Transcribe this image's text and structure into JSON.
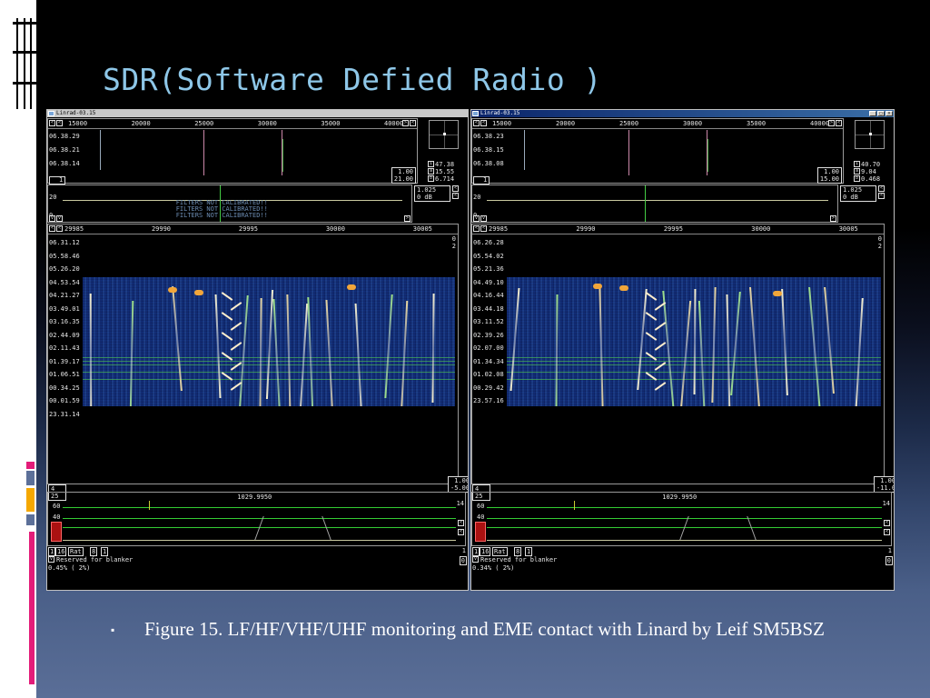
{
  "slide": {
    "title": "SDR(Software Defied Radio )",
    "caption": "Figure 15.  LF/HF/VHF/UHF  monitoring and EME contact with Linard by Leif SM5BSZ",
    "bullet": "▪",
    "colors": {
      "title": "#8ec7e8",
      "caption": "#ffffff",
      "accents": [
        "#e31c79",
        "#5c7099",
        "#f5a800",
        "#5c7099"
      ]
    }
  },
  "windows": [
    {
      "title": "Linrad-03.15",
      "active": false,
      "wide_freq_ticks": [
        "15000",
        "20000",
        "25000",
        "30000",
        "35000",
        "40000"
      ],
      "wide_times": [
        "06.38.29",
        "06.38.21",
        "06.38.14"
      ],
      "wide_box": [
        "1.00",
        "21.00"
      ],
      "side_values": [
        "47.38",
        "15.55",
        "6.714"
      ],
      "side_mini": [
        "1"
      ],
      "scale_box": [
        "1.025",
        "0 dB"
      ],
      "baseline_labels": [
        "20",
        "0"
      ],
      "filters_text": [
        "FILTERS NOT CALIBRATED!!",
        "FILTERS NOT CALIBRATED!!",
        "FILTERS NOT CALIBRATED!!"
      ],
      "main_freq_ticks": [
        "29985",
        "29990",
        "29995",
        "30000",
        "30005"
      ],
      "main_right": [
        "0",
        "2"
      ],
      "main_times": [
        "06.31.12",
        "05.58.46",
        "05.26.20",
        "04.53.54",
        "04.21.27",
        "03.49.01",
        "03.16.35",
        "02.44.09",
        "02.11.43",
        "01.39.17",
        "01.06.51",
        "00.34.25",
        "00.01.59",
        "23.31.14"
      ],
      "lower_box": [
        "1.00",
        "-5.00"
      ],
      "lower_left": [
        "4",
        "25"
      ],
      "center_freq": "1029.9950",
      "lower_right": "14",
      "level_labels": [
        "60",
        "40",
        "20"
      ],
      "bottom_controls": [
        "1",
        "16",
        "Rat",
        "8",
        "1"
      ],
      "bottom_text": "Reserved for blanker",
      "bottom_right": [
        "1",
        "0"
      ],
      "status": "0.45%  ( 2%)"
    },
    {
      "title": "Linrad-03.15",
      "active": true,
      "wide_freq_ticks": [
        "15000",
        "20000",
        "25000",
        "30000",
        "35000",
        "40000"
      ],
      "wide_times": [
        "06.38.23",
        "06.38.15",
        "06.38.08"
      ],
      "wide_box": [
        "1.00",
        "15.00"
      ],
      "side_values": [
        "40.70",
        "9.04",
        "0.468"
      ],
      "side_mini": [
        "1"
      ],
      "scale_box": [
        "1.025",
        "0 dB"
      ],
      "baseline_labels": [
        "20",
        "0"
      ],
      "filters_text": [],
      "main_freq_ticks": [
        "29985",
        "29990",
        "29995",
        "30000",
        "30005"
      ],
      "main_right": [
        "0",
        "2"
      ],
      "main_times": [
        "06.26.28",
        "05.54.02",
        "05.21.36",
        "04.49.10",
        "04.16.44",
        "03.44.18",
        "03.11.52",
        "02.39.26",
        "02.07.00",
        "01.34.34",
        "01.02.08",
        "00.29.42",
        "23.57.16"
      ],
      "lower_box": [
        "1.00",
        "-11.0"
      ],
      "lower_left": [
        "4",
        "25"
      ],
      "center_freq": "1029.9950",
      "lower_right": "14",
      "level_labels": [
        "60",
        "40",
        "20"
      ],
      "bottom_controls": [
        "1",
        "16",
        "Rat",
        "8",
        "1"
      ],
      "bottom_text": "Reserved for blanker",
      "bottom_right": [
        "1",
        "0"
      ],
      "status": "0.34%  ( 2%)"
    }
  ]
}
